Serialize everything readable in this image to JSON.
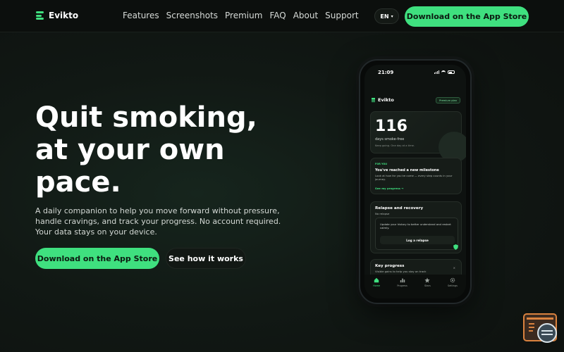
{
  "brand": {
    "name": "Evikto",
    "accent": "#3fe07f"
  },
  "nav": {
    "links": [
      "Features",
      "Screenshots",
      "Premium",
      "FAQ",
      "About",
      "Support"
    ],
    "language": "EN",
    "cta_label": "Download on the App Store"
  },
  "hero": {
    "title_lines": [
      "Quit smoking,",
      "at your own",
      "pace."
    ],
    "subtitle": "A daily companion to help you move forward without pressure, handle cravings, and track your progress. No account required. Your data stays on your device.",
    "primary_label": "Download on the App Store",
    "secondary_label": "See how it works"
  },
  "phone": {
    "status_time": "21:09",
    "app_name": "Evikto",
    "badge": "Premium plan",
    "days_count": "116",
    "days_label": "days smoke-free",
    "days_hint": "Keep going. One day at a time.",
    "milestone": {
      "tag": "FOR YOU",
      "title": "You've reached a new milestone",
      "text": "Look at how far you've come — every step counts in your journey.",
      "link": "See my progress →"
    },
    "relapse": {
      "title": "Relapse and recovery",
      "subtitle": "No relapse",
      "text": "Update your history to better understand and restart calmly.",
      "button": "Log a relapse"
    },
    "key_progress": {
      "title": "Key progress",
      "subtitle": "Visible gains to help you stay on track",
      "close": "×"
    },
    "tabs": [
      {
        "label": "Home",
        "icon": "home-icon"
      },
      {
        "label": "Progress",
        "icon": "chart-icon"
      },
      {
        "label": "Stars",
        "icon": "stars-icon"
      },
      {
        "label": "Settings",
        "icon": "gear-icon"
      }
    ]
  }
}
